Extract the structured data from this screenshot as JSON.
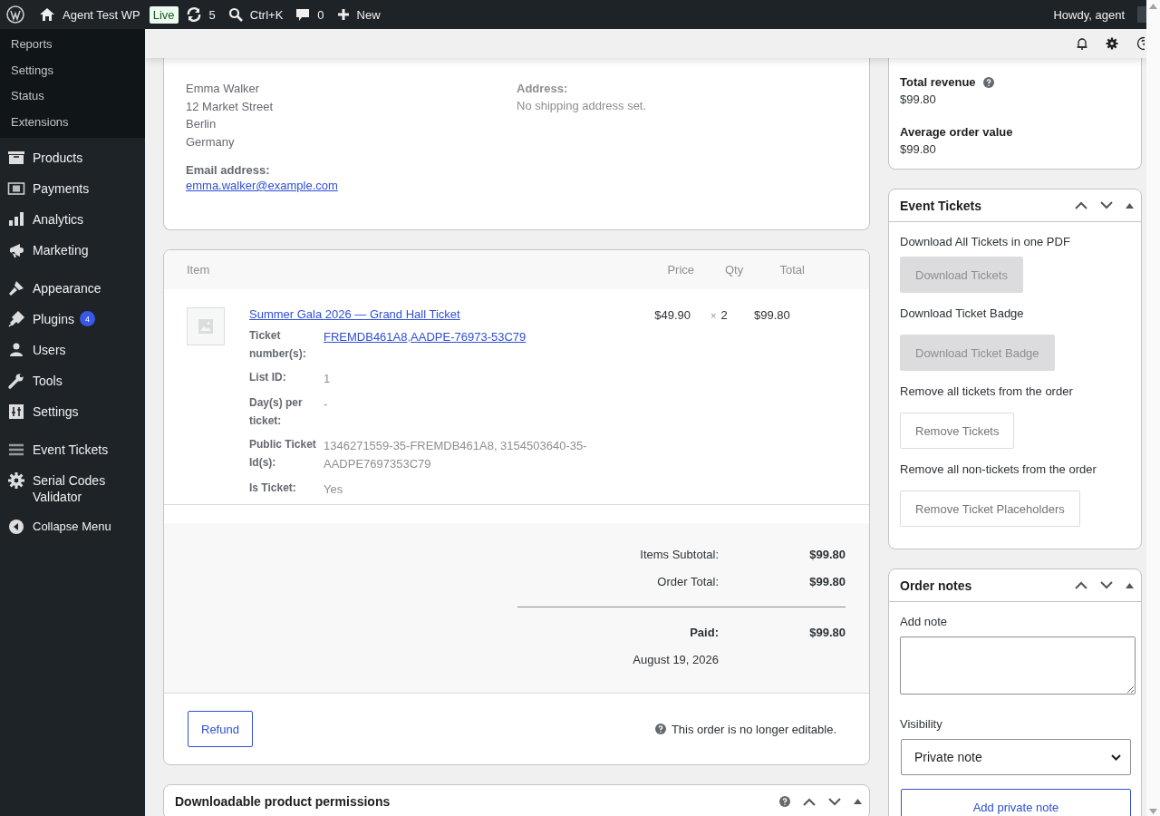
{
  "admin_bar": {
    "site_name": "Agent Test WP",
    "live_badge": "Live",
    "updates_count": "5",
    "search_shortcut": "Ctrl+K",
    "comments_count": "0",
    "new_label": "New",
    "greeting": "Howdy, agent"
  },
  "sidebar": {
    "submenu": [
      {
        "label": "Reports"
      },
      {
        "label": "Settings"
      },
      {
        "label": "Status"
      },
      {
        "label": "Extensions"
      }
    ],
    "groups": [
      {
        "items": [
          {
            "label": "Products"
          },
          {
            "label": "Payments"
          },
          {
            "label": "Analytics"
          },
          {
            "label": "Marketing"
          }
        ]
      },
      {
        "items": [
          {
            "label": "Appearance"
          },
          {
            "label": "Plugins",
            "badge": "4"
          },
          {
            "label": "Users"
          },
          {
            "label": "Tools"
          },
          {
            "label": "Settings"
          }
        ]
      },
      {
        "items": [
          {
            "label": "Event Tickets"
          },
          {
            "label": "Serial Codes Validator"
          },
          {
            "label": "Collapse Menu"
          }
        ]
      }
    ]
  },
  "billing": {
    "lines": [
      "Emma Walker",
      "12 Market Street",
      "Berlin",
      "Germany"
    ],
    "email_label": "Email address:",
    "email": "emma.walker@example.com"
  },
  "shipping": {
    "address_label": "Address:",
    "address_value": "No shipping address set."
  },
  "order_items": {
    "columns": [
      "Item",
      "Price",
      "Qty",
      "Total"
    ],
    "items": [
      {
        "name": "Summer Gala 2026 — Grand Hall Ticket",
        "price": "$49.90",
        "qty_sign": "×",
        "qty": "2",
        "total": "$99.80",
        "meta": [
          {
            "label": "Ticket number(s):",
            "kind": "links",
            "links": [
              "FREMDB461A8",
              "AADPE-76973-53C79"
            ],
            "separator": ","
          },
          {
            "label": "List ID:",
            "kind": "text",
            "value": "1"
          },
          {
            "label": "Day(s) per ticket:",
            "kind": "text",
            "value": "-"
          },
          {
            "label": "Public Ticket Id(s):",
            "kind": "text",
            "value": "1346271559-35-FREMDB461A8, 3154503640-35-AADPE7697353C79"
          },
          {
            "label": "Is Ticket:",
            "kind": "text",
            "value": "Yes"
          }
        ]
      }
    ],
    "totals": [
      {
        "label": "Items Subtotal:",
        "value": "$99.80"
      },
      {
        "label": "Order Total:",
        "value": "$99.80"
      }
    ],
    "paid": {
      "label": "Paid:",
      "value": "$99.80",
      "date": "August 19, 2026"
    },
    "refund_button": "Refund",
    "not_editable_note": "This order is no longer editable."
  },
  "downloads": {
    "title": "Downloadable product permissions"
  },
  "revenue": [
    {
      "label": "Total revenue",
      "value": "$99.80",
      "help": true
    },
    {
      "label": "Average order value",
      "value": "$99.80",
      "help": false
    }
  ],
  "event_tickets": {
    "title": "Event Tickets",
    "actions": [
      {
        "label": "Download All Tickets in one PDF",
        "button": "Download Tickets",
        "disabled": true
      },
      {
        "label": "Download Ticket Badge",
        "button": "Download Ticket Badge",
        "disabled": true
      },
      {
        "label": "Remove all tickets from the order",
        "button": "Remove Tickets",
        "disabled": false
      },
      {
        "label": "Remove all non-tickets from the order",
        "button": "Remove Ticket Placeholders",
        "disabled": false
      }
    ]
  },
  "order_notes": {
    "title": "Order notes",
    "add_note_label": "Add note",
    "visibility_label": "Visibility",
    "visibility_value": "Private note",
    "add_button": "Add private note"
  }
}
